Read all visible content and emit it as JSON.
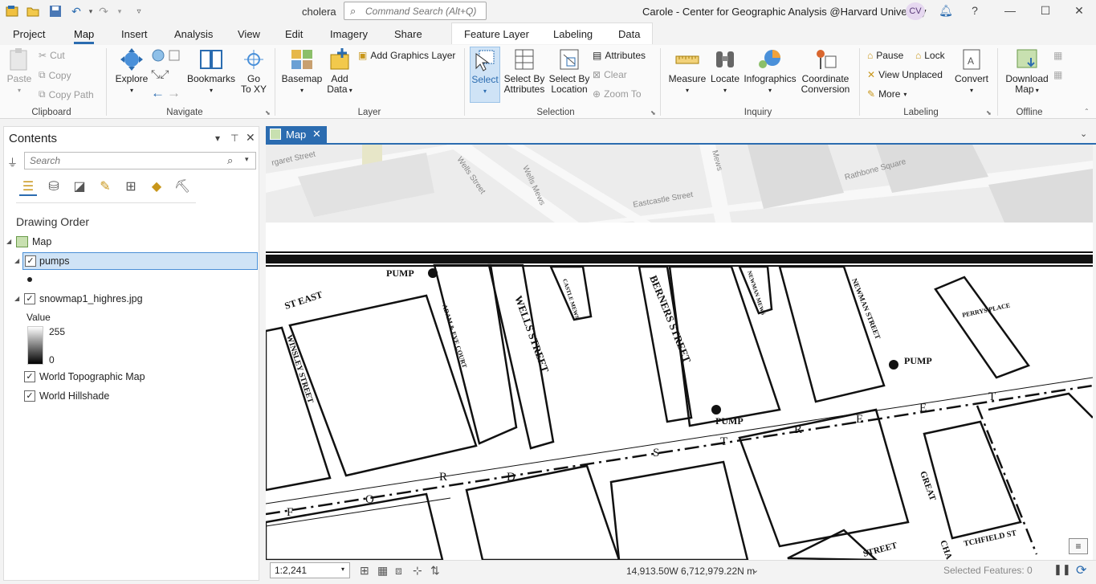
{
  "titlebar": {
    "project_name": "cholera",
    "search_placeholder": "Command Search (Alt+Q)",
    "user_text": "Carole - Center for Geographic Analysis @Harvard University",
    "avatar_initials": "CV",
    "help": "?"
  },
  "ribbon_tabs": [
    "Project",
    "Map",
    "Insert",
    "Analysis",
    "View",
    "Edit",
    "Imagery",
    "Share",
    "Feature Layer",
    "Labeling",
    "Data"
  ],
  "active_tab": "Map",
  "ribbon": {
    "clipboard": {
      "paste": "Paste",
      "cut": "Cut",
      "copy": "Copy",
      "copy_path": "Copy Path",
      "label": "Clipboard"
    },
    "navigate": {
      "explore": "Explore",
      "bookmarks": "Bookmarks",
      "go_to_xy_1": "Go",
      "go_to_xy_2": "To XY",
      "label": "Navigate"
    },
    "layer": {
      "basemap": "Basemap",
      "add_data_1": "Add",
      "add_data_2": "Data",
      "add_graphics": "Add Graphics Layer",
      "label": "Layer"
    },
    "selection": {
      "select": "Select",
      "select_by_attr_1": "Select By",
      "select_by_attr_2": "Attributes",
      "select_by_loc_1": "Select By",
      "select_by_loc_2": "Location",
      "attributes": "Attributes",
      "clear": "Clear",
      "zoom_to": "Zoom To",
      "label": "Selection"
    },
    "inquiry": {
      "measure": "Measure",
      "locate": "Locate",
      "infographics": "Infographics",
      "coord_conv_1": "Coordinate",
      "coord_conv_2": "Conversion",
      "label": "Inquiry"
    },
    "labeling": {
      "pause": "Pause",
      "lock": "Lock",
      "view_unplaced": "View Unplaced",
      "more": "More",
      "convert": "Convert",
      "label": "Labeling"
    },
    "offline": {
      "download_1": "Download",
      "download_2": "Map",
      "label": "Offline"
    }
  },
  "contents": {
    "title": "Contents",
    "search_placeholder": "Search",
    "drawing_order": "Drawing Order",
    "map_node": "Map",
    "layers": [
      {
        "name": "pumps",
        "checked": true,
        "selected": true
      },
      {
        "name": "snowmap1_highres.jpg",
        "checked": true
      },
      {
        "name": "World Topographic Map",
        "checked": true
      },
      {
        "name": "World Hillshade",
        "checked": true
      }
    ],
    "legend": {
      "title": "Value",
      "high": "255",
      "low": "0"
    }
  },
  "map_tab": {
    "label": "Map"
  },
  "basemap_labels": [
    "rgaret Street",
    "Wells Street",
    "Wells Mews",
    "Eastcastle Street",
    "Mews",
    "Rathbone Square"
  ],
  "historic_labels": {
    "pump": "PUMP",
    "st_east": "ST  EAST",
    "adam_eve": "ADAM & EVE COURT",
    "castle_mews": "CASTLE MEWS",
    "wells_street": "WELLS  STREET",
    "berners_street": "BERNERS  STREET",
    "newman_mews": "NEWMAN MEWS",
    "newman_street": "NEWMAN STREET",
    "perrys_place": "PERRYS PLACE",
    "winsley_street": "WINSLEY  STREET",
    "great": "GREAT",
    "street": "STREET",
    "chapel": "CHA",
    "chesterfield": "TCHFIELD ST",
    "oxford_letters": [
      "F",
      "O",
      "R",
      "D",
      "S",
      "T",
      "R",
      "E",
      "E",
      "T"
    ]
  },
  "status": {
    "scale": "1:2,241",
    "coordinates": "14,913.50W 6,712,979.22N m",
    "selected_features": "Selected Features: 0"
  },
  "colors": {
    "accent": "#2b6cb0",
    "selection_highlight": "#cfe3f6",
    "basemap_bg": "#ececec",
    "basemap_block": "#dcdcdc"
  }
}
